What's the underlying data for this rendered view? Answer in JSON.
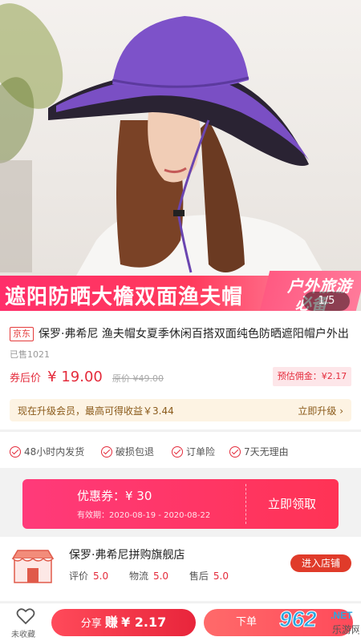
{
  "hero": {
    "banner_title": "遮阳防晒大檐双面渔夫帽",
    "banner_slogan_1": "户外旅游",
    "banner_slogan_2": "必备",
    "pager": "1/5"
  },
  "product": {
    "platform_tag": "京东",
    "title": "保罗·弗希尼  渔夫帽女夏季休闲百搭双面纯色防晒遮阳帽户外出",
    "sold": "已售1021",
    "price_label": "券后价",
    "price": "¥ 19.00",
    "original_price": "原价 ¥49.00",
    "commission": "预估佣金：¥2.17"
  },
  "upgrade": {
    "text": "现在升级会员，最高可得收益￥3.44",
    "button": "立即升级"
  },
  "services": [
    "48小时内发货",
    "破损包退",
    "订单险",
    "7天无理由"
  ],
  "coupon": {
    "label": "优惠券：¥ 30",
    "validity": "有效期：2020-08-19 - 2020-08-22",
    "button": "立即领取"
  },
  "shop": {
    "name": "保罗·弗希尼拼购旗舰店",
    "ratings": [
      {
        "label": "评价",
        "value": "5.0"
      },
      {
        "label": "物流",
        "value": "5.0"
      },
      {
        "label": "售后",
        "value": "5.0"
      }
    ],
    "enter_button": "进入店铺"
  },
  "bottom_bar": {
    "favorite_label": "未收藏",
    "share_prefix": "分享",
    "share_earn": "赚",
    "share_amount": "¥ 2.17",
    "buy_label": "下单"
  },
  "watermark": {
    "logo": "962",
    "suffix": ".NET",
    "sub": "乐游网"
  },
  "colors": {
    "accent_red": "#e42b3b",
    "hat_purple": "#7a4fc4",
    "banner_pink": "#ff2e6a"
  }
}
